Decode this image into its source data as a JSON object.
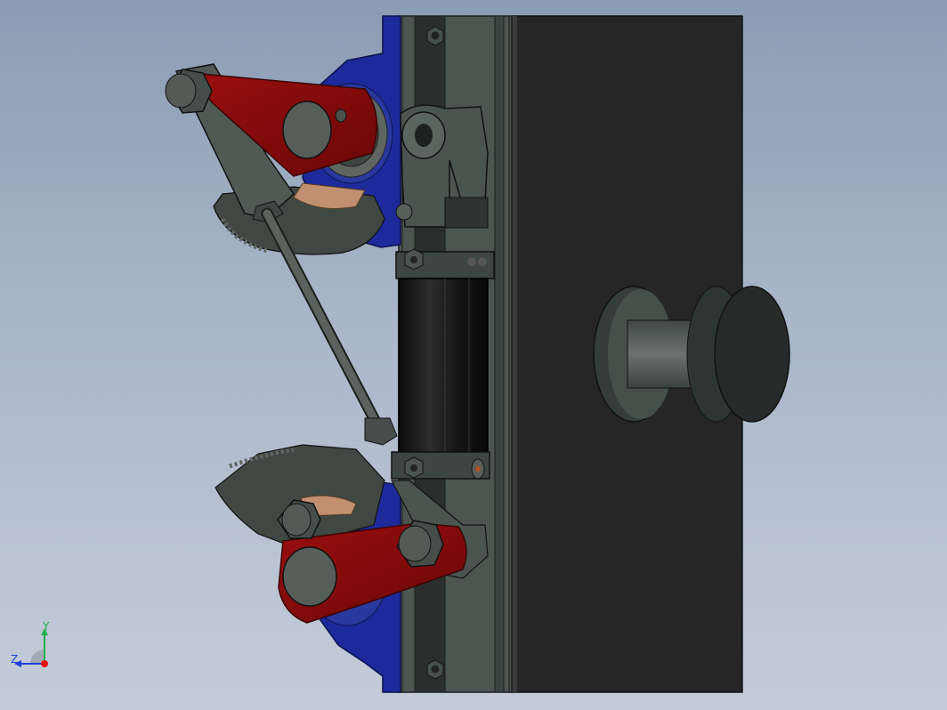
{
  "viewport": {
    "background_top": "#8a9cb4",
    "background_bottom": "#c4ccd9"
  },
  "triad": {
    "y_label": "Y",
    "z_label": "Z",
    "y_color": "#22b14c",
    "z_color": "#1e3fd4",
    "x_color": "#e01010"
  },
  "colors": {
    "housing": "#272727",
    "plate": "#4b5650",
    "bearing_blue": "#1d2a9b",
    "lever_red": "#8b0b0b",
    "steel": "#5b625e",
    "cylinder": "#151515",
    "bronze": "#c09070"
  },
  "parts": [
    "housing-block-body",
    "mounting-plate",
    "upper-pillow-block-bearing",
    "lower-pillow-block-bearing",
    "upper-crank-lever",
    "lower-crank-lever",
    "connecting-rod",
    "pneumatic-cylinder",
    "upper-gear-sector",
    "lower-gear-sector",
    "spool-knob"
  ]
}
